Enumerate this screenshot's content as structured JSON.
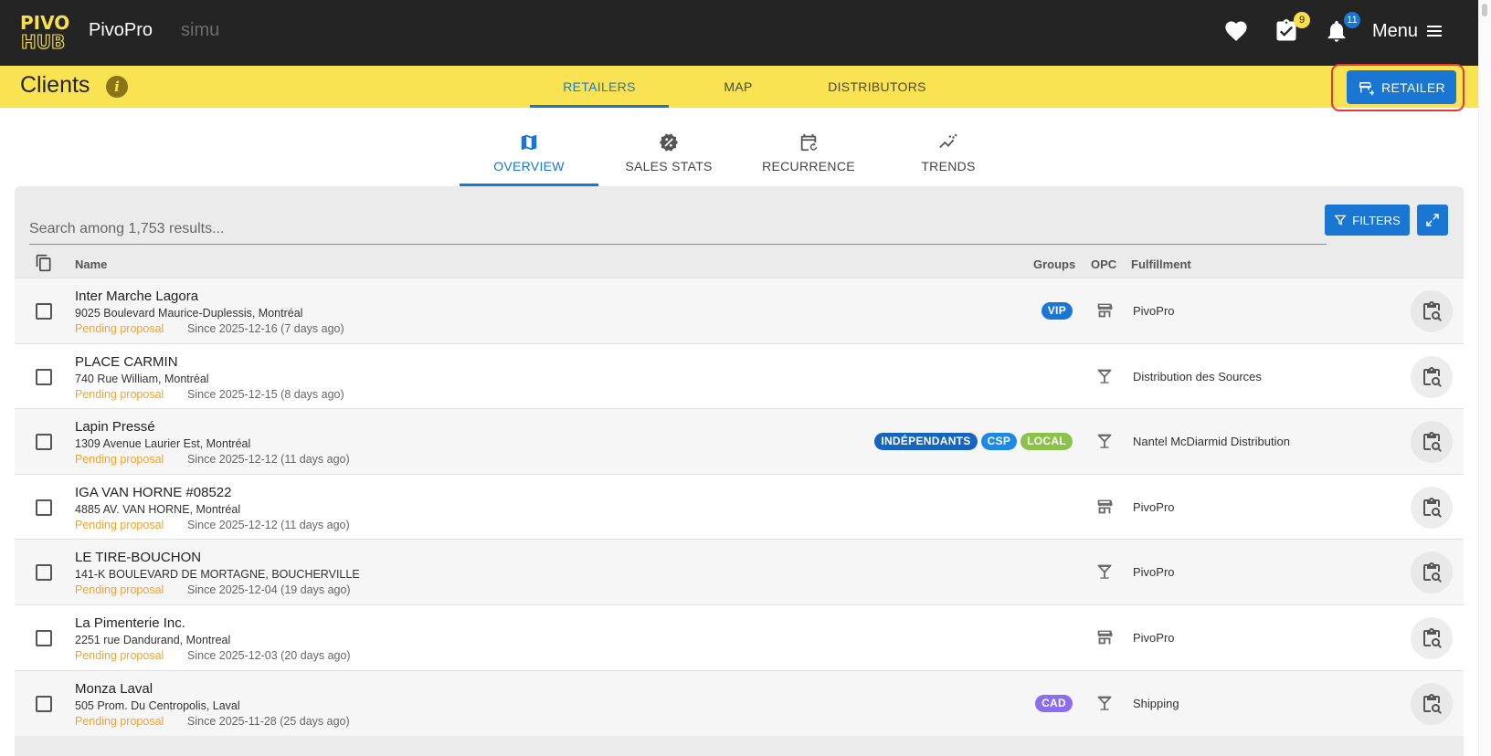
{
  "app": {
    "logo_text": "PIVO HUB",
    "name": "PivoPro",
    "environment": "simu"
  },
  "topbar": {
    "tasks_badge": "9",
    "notifications_badge": "11",
    "menu_label": "Menu"
  },
  "header": {
    "title": "Clients",
    "info_glyph": "i",
    "tabs": [
      {
        "label": "RETAILERS",
        "active": true
      },
      {
        "label": "MAP",
        "active": false
      },
      {
        "label": "DISTRIBUTORS",
        "active": false
      }
    ],
    "add_button_label": "RETAILER"
  },
  "subtabs": [
    {
      "label": "OVERVIEW",
      "icon": "map-icon",
      "active": true
    },
    {
      "label": "SALES STATS",
      "icon": "percent-badge-icon",
      "active": false
    },
    {
      "label": "RECURRENCE",
      "icon": "calendar-repeat-icon",
      "active": false
    },
    {
      "label": "TRENDS",
      "icon": "trend-icon",
      "active": false
    }
  ],
  "search": {
    "placeholder": "Search among 1,753 results..."
  },
  "toolbar": {
    "filters_label": "FILTERS"
  },
  "table": {
    "columns": {
      "name": "Name",
      "groups": "Groups",
      "opc": "OPC",
      "fulfillment": "Fulfillment"
    },
    "rows": [
      {
        "name": "Inter Marche Lagora",
        "address": "9025 Boulevard Maurice-Duplessis, Montréal",
        "status": "Pending proposal",
        "since": "Since 2025-12-16 (7 days ago)",
        "tags": [
          {
            "label": "VIP",
            "color": "#1976d2"
          }
        ],
        "opc": "store-icon",
        "fulfillment": "PivoPro"
      },
      {
        "name": "PLACE CARMIN",
        "address": "740 Rue William, Montréal",
        "status": "Pending proposal",
        "since": "Since 2025-12-15 (8 days ago)",
        "tags": [],
        "opc": "cocktail-glass-icon",
        "fulfillment": "Distribution des Sources"
      },
      {
        "name": "Lapin Pressé",
        "address": "1309 Avenue Laurier Est, Montréal",
        "status": "Pending proposal",
        "since": "Since 2025-12-12 (11 days ago)",
        "tags": [
          {
            "label": "INDÉPENDANTS",
            "color": "#1565c0"
          },
          {
            "label": "CSP",
            "color": "#1e88e5"
          },
          {
            "label": "LOCAL",
            "color": "#8bc34a"
          }
        ],
        "opc": "cocktail-glass-icon",
        "fulfillment": "Nantel McDiarmid Distribution"
      },
      {
        "name": "IGA VAN HORNE #08522",
        "address": "4885 AV. VAN HORNE, Montréal",
        "status": "Pending proposal",
        "since": "Since 2025-12-12 (11 days ago)",
        "tags": [],
        "opc": "store-icon",
        "fulfillment": "PivoPro"
      },
      {
        "name": "LE TIRE-BOUCHON",
        "address": "141-K BOULEVARD DE MORTAGNE, BOUCHERVILLE",
        "status": "Pending proposal",
        "since": "Since 2025-12-04 (19 days ago)",
        "tags": [],
        "opc": "cocktail-glass-icon",
        "fulfillment": "PivoPro"
      },
      {
        "name": "La Pimenterie Inc.",
        "address": "2251 rue Dandurand, Montreal",
        "status": "Pending proposal",
        "since": "Since 2025-12-03 (20 days ago)",
        "tags": [],
        "opc": "store-icon",
        "fulfillment": "PivoPro"
      },
      {
        "name": "Monza Laval",
        "address": "505 Prom. Du Centropolis, Laval",
        "status": "Pending proposal",
        "since": "Since 2025-11-28 (25 days ago)",
        "tags": [
          {
            "label": "CAD",
            "color": "#8c6df0"
          }
        ],
        "opc": "cocktail-glass-icon",
        "fulfillment": "Shipping"
      }
    ]
  },
  "colors": {
    "topbar": "#242424",
    "header": "#fae352",
    "accent": "#1976d2",
    "pending": "#f3a32a",
    "highlight_outline": "#e53935"
  }
}
